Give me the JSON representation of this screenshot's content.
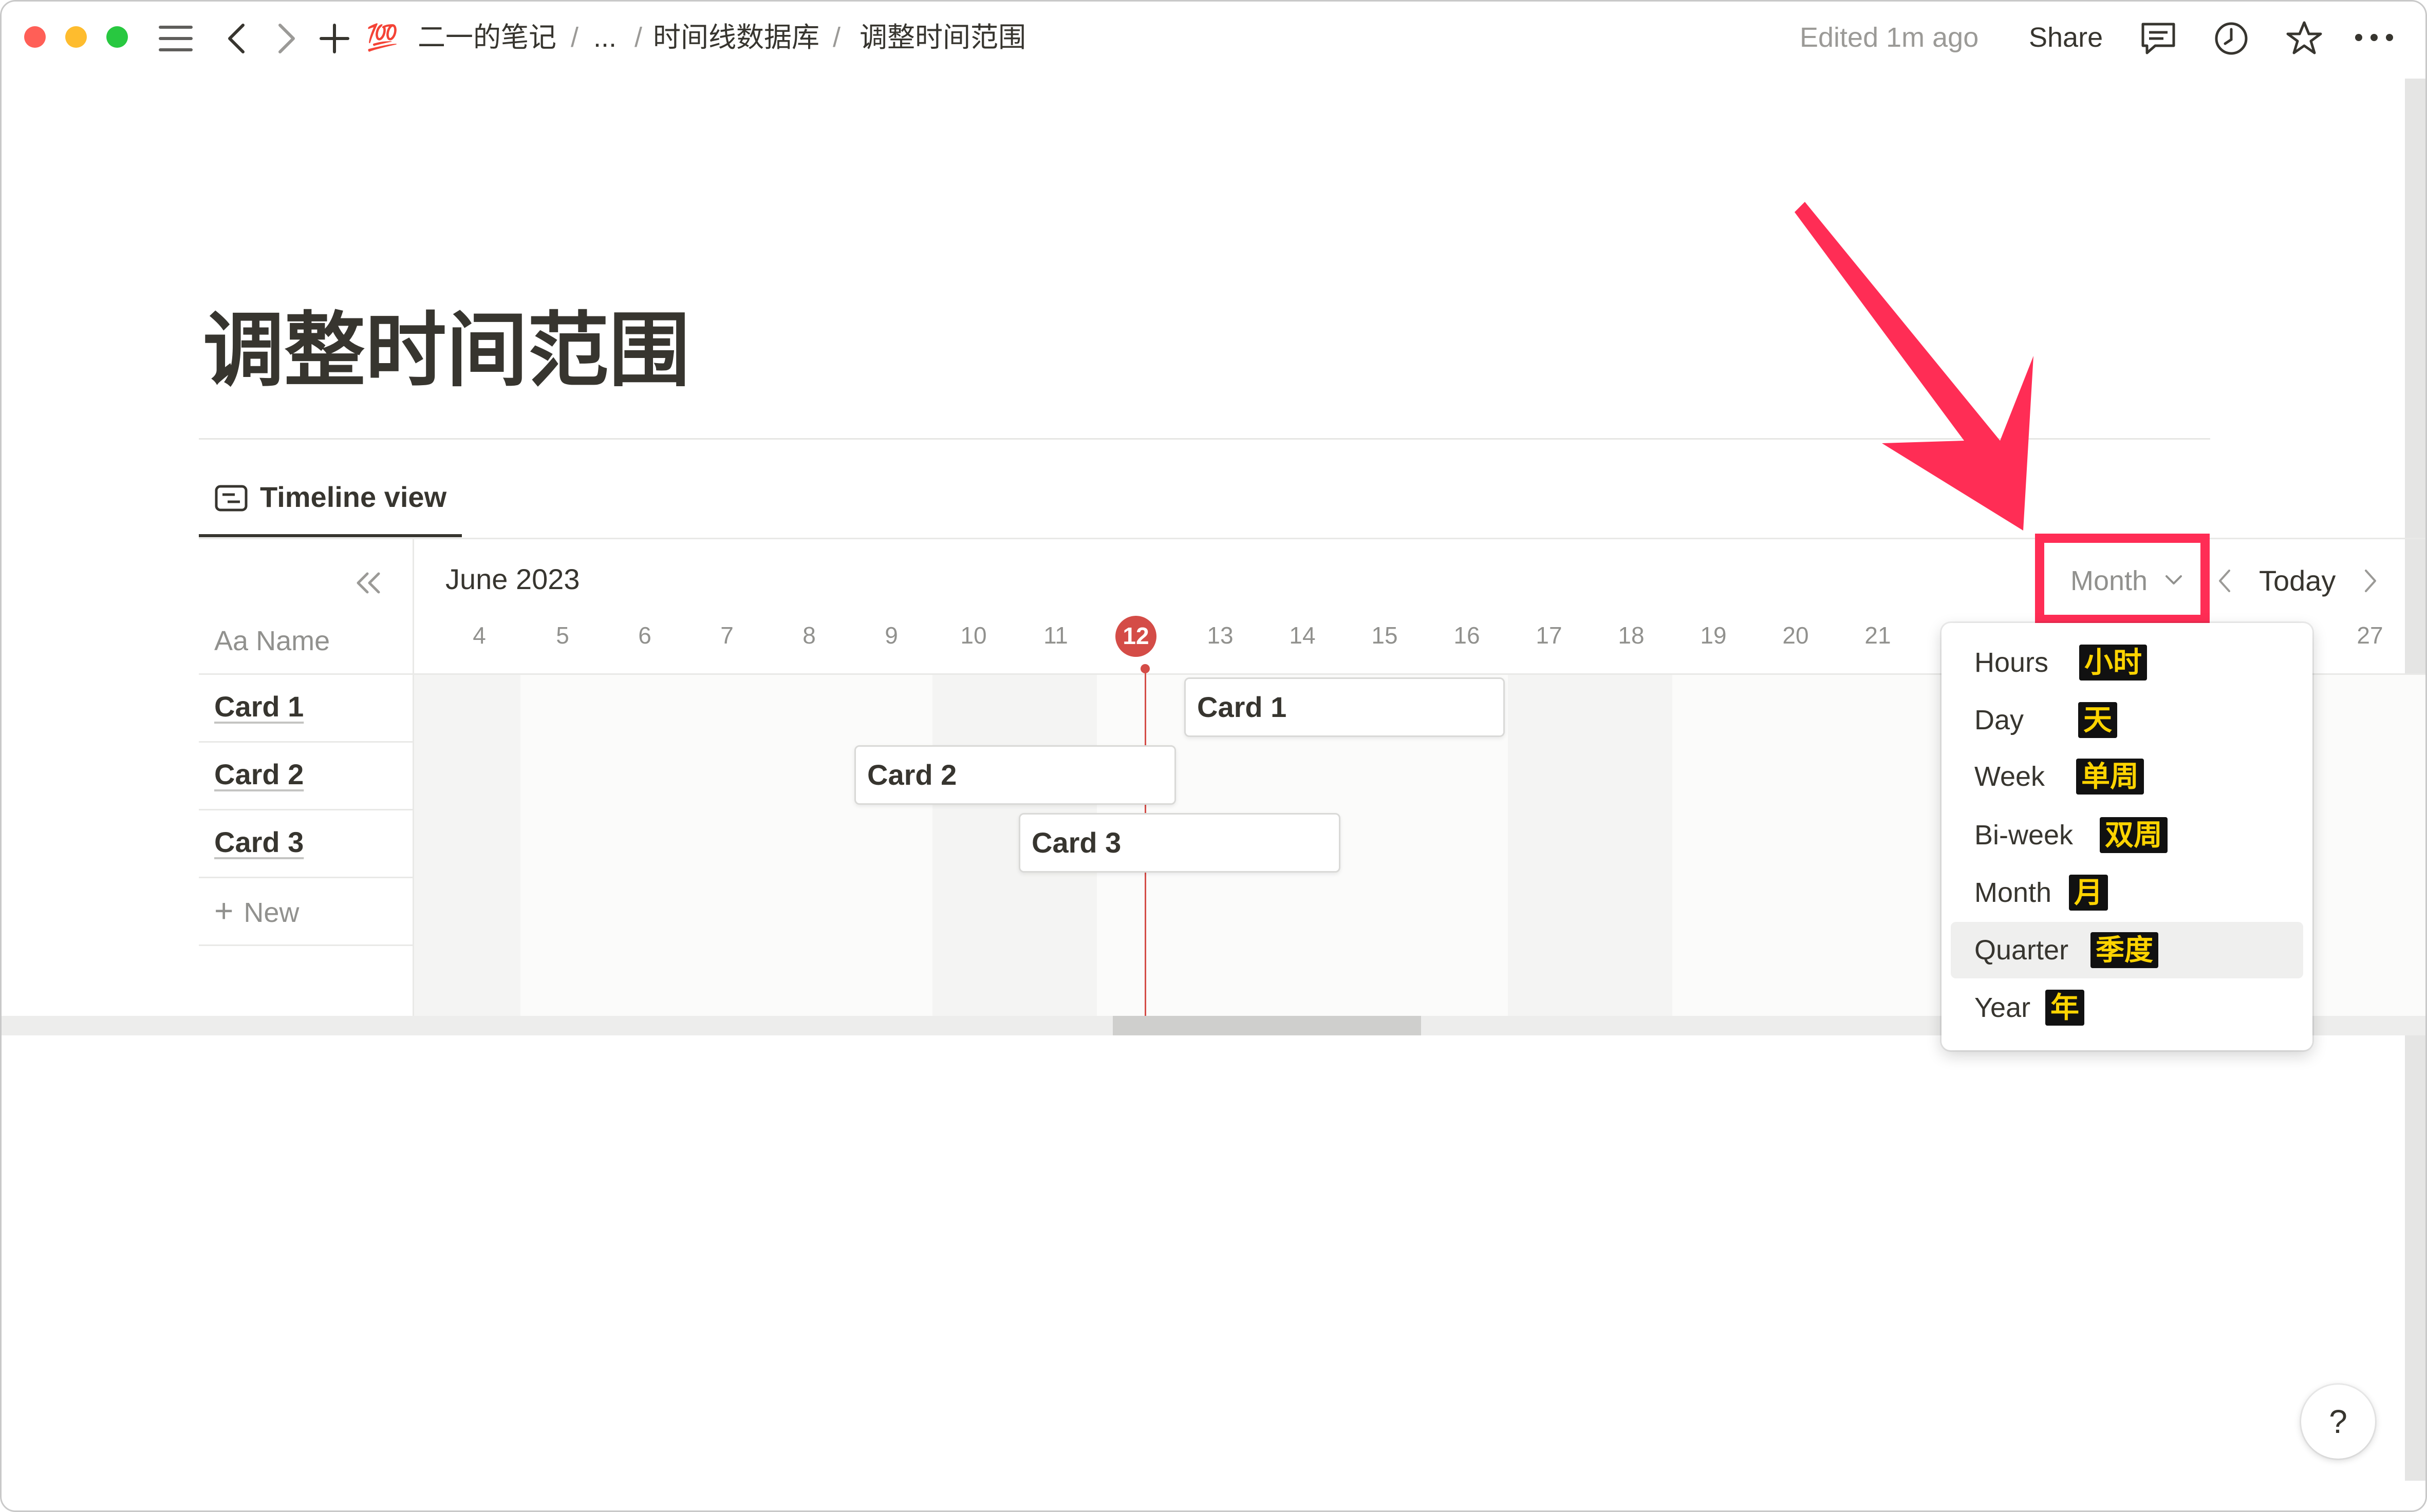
{
  "topbar": {
    "breadcrumb_emoji": "💯",
    "breadcrumb": [
      "二一的笔记",
      "...",
      "时间线数据库",
      "调整时间范围"
    ],
    "separator": "/",
    "edited": "Edited 1m ago",
    "share": "Share"
  },
  "page": {
    "title": "调整时间范围",
    "tab_label": "Timeline view"
  },
  "timeline": {
    "month_label": "June 2023",
    "days": [
      "4",
      "5",
      "6",
      "7",
      "8",
      "9",
      "10",
      "11",
      "12",
      "13",
      "14",
      "15",
      "16",
      "17",
      "18",
      "19",
      "20",
      "21",
      "27"
    ],
    "today_day": "12",
    "name_header_prefix": "Aa",
    "name_header": "Name",
    "rows": [
      "Card 1",
      "Card 2",
      "Card 3"
    ],
    "new_label": "New",
    "range_button": "Month",
    "today_button": "Today",
    "bars": [
      {
        "name": "Card 1",
        "start": "13",
        "end": "16"
      },
      {
        "name": "Card 2",
        "start": "9",
        "end": "12"
      },
      {
        "name": "Card 3",
        "start": "11",
        "end": "14"
      }
    ]
  },
  "dropdown": {
    "items": [
      {
        "label": "Hours",
        "badge": "小时"
      },
      {
        "label": "Day",
        "badge": "天"
      },
      {
        "label": "Week",
        "badge": "单周"
      },
      {
        "label": "Bi-week",
        "badge": "双周"
      },
      {
        "label": "Month",
        "badge": "月"
      },
      {
        "label": "Quarter",
        "badge": "季度"
      },
      {
        "label": "Year",
        "badge": "年"
      }
    ],
    "hovered": "Quarter"
  },
  "help": {
    "label": "?"
  },
  "colors": {
    "today_red": "#d44c47",
    "annotation_red": "#ff2d55",
    "badge_bg": "#111111",
    "badge_text": "#ffd400",
    "traffic_close": "#ff5f57",
    "traffic_min": "#febc2e",
    "traffic_max": "#28c840"
  },
  "icons": [
    "menu-icon",
    "back-icon",
    "forward-icon",
    "plus-icon",
    "comment-icon",
    "clock-icon",
    "star-icon",
    "more-icon",
    "timeline-icon",
    "collapse-icon",
    "chevron-down-icon",
    "prev-icon",
    "next-icon",
    "annotation-arrow-icon"
  ]
}
